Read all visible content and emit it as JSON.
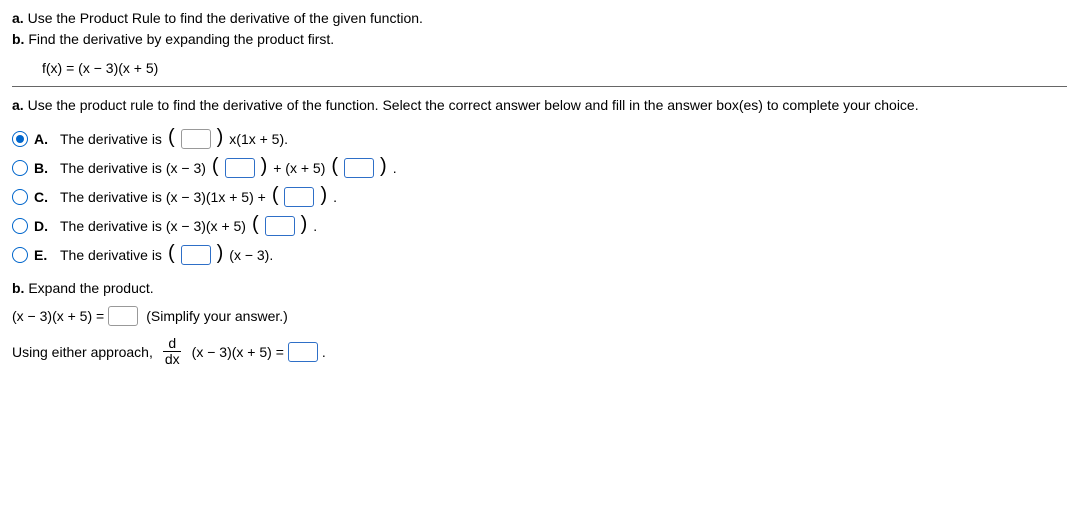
{
  "instructions": {
    "a_label": "a.",
    "a_text": "Use the Product Rule to find the derivative of the given function.",
    "b_label": "b.",
    "b_text": "Find the derivative by expanding the product first."
  },
  "formula": "f(x) = (x − 3)(x + 5)",
  "part_a_prompt_label": "a.",
  "part_a_prompt": "Use the product rule to find the derivative of the function. Select the correct answer below and fill in the answer box(es) to complete your choice.",
  "options": {
    "A": {
      "letter": "A.",
      "prefix": "The derivative is ",
      "post": " x(1x + 5).",
      "selected": true
    },
    "B": {
      "letter": "B.",
      "prefix": "The derivative is (x − 3)",
      "mid": " + (x + 5)",
      "end": " .",
      "selected": false
    },
    "C": {
      "letter": "C.",
      "prefix": "The derivative is (x − 3)(1x + 5) + ",
      "end": " .",
      "selected": false
    },
    "D": {
      "letter": "D.",
      "prefix": "The derivative is (x − 3)(x + 5)",
      "end": " .",
      "selected": false
    },
    "E": {
      "letter": "E.",
      "prefix": "The derivative is ",
      "post": " (x − 3).",
      "selected": false
    }
  },
  "part_b": {
    "label": "b.",
    "prompt": "Expand the product.",
    "expand_lhs": "(x − 3)(x + 5) =",
    "simplify_hint": "(Simplify your answer.)",
    "final_prefix": "Using either approach, ",
    "frac_num": "d",
    "frac_den": "dx",
    "final_mid": "(x − 3)(x + 5) =",
    "final_end": "."
  }
}
